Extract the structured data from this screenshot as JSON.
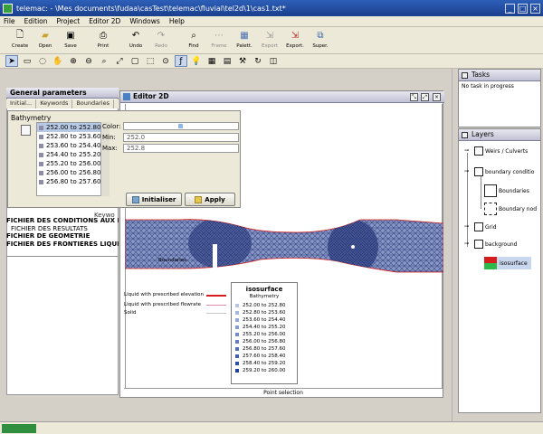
{
  "window": {
    "title": "telemac: - \\Mes documents\\fudaa\\casTest\\telemac\\fluvial\\tel2d\\1\\cas1.txt*"
  },
  "menu": [
    "File",
    "Edition",
    "Project",
    "Editor 2D",
    "Windows",
    "Help"
  ],
  "toolbar": [
    {
      "label": "Create",
      "icon": "document-icon",
      "enabled": true
    },
    {
      "label": "Open",
      "icon": "folder-icon",
      "enabled": true
    },
    {
      "label": "Save",
      "icon": "floppy-icon",
      "enabled": true
    },
    {
      "label": "Print",
      "icon": "printer-icon",
      "enabled": true
    },
    {
      "label": "Undo",
      "icon": "undo-icon",
      "enabled": true
    },
    {
      "label": "Redo",
      "icon": "redo-icon",
      "enabled": false
    },
    {
      "label": "Find",
      "icon": "find-icon",
      "enabled": true
    },
    {
      "label": "Frame",
      "icon": "frame-icon",
      "enabled": false
    },
    {
      "label": "Palett.",
      "icon": "palette-icon",
      "enabled": true
    },
    {
      "label": "Export",
      "icon": "export-icon",
      "enabled": false
    },
    {
      "label": "Export.",
      "icon": "export-icon",
      "enabled": true
    },
    {
      "label": "Super.",
      "icon": "superimpose-icon",
      "enabled": true
    }
  ],
  "general_parameters": {
    "title": "General parameters",
    "tabs": [
      "Initial...",
      "Keywords",
      "Boundaries"
    ],
    "keywords_label": "Keywo",
    "keywords": [
      {
        "text": "FICHIER DES CONDITIONS AUX LIMI",
        "bold": true
      },
      {
        "text": "FICHIER DES RESULTATS",
        "bold": false
      },
      {
        "text": "FICHIER DE GEOMETRIE",
        "bold": true
      },
      {
        "text": "FICHIER DES FRONTIERES LIQUIDES",
        "bold": true
      }
    ]
  },
  "bathymetry_panel": {
    "title": "Bathymetry",
    "ranges": [
      "252.00 to 252.80",
      "252.80 to 253.60",
      "253.60 to 254.40",
      "254.40 to 255.20",
      "255.20 to 256.00",
      "256.00 to 256.80",
      "256.80 to 257.60"
    ],
    "color_label": "Color:",
    "min_label": "Min:",
    "min_value": "252.0",
    "max_label": "Max:",
    "max_value": "252.8",
    "initialise_label": "Initialiser",
    "apply_label": "Apply"
  },
  "editor": {
    "title": "Editor 2D",
    "status": "Point selection",
    "boundaries_title": "Boundaries",
    "boundary_legend": [
      {
        "label": "Liquid with prescribed elevation",
        "color": "#d61c1c"
      },
      {
        "label": "Liquid with prescribed flowrate",
        "color": "#e08ab2"
      },
      {
        "label": "Solid",
        "color": "#c7c7c7"
      }
    ],
    "iso": {
      "title": "isosurface",
      "subtitle": "Bathymetry",
      "ranges": [
        "252.00 to 252.80",
        "252.80 to 253.60",
        "253.60 to 254.40",
        "254.40 to 255.20",
        "255.20 to 256.00",
        "256.00 to 256.80",
        "256.80 to 257.60",
        "257.60 to 258.40",
        "258.40 to 259.20",
        "259.20 to 260.00"
      ],
      "colors": [
        "#b8c6e6",
        "#a7b8de",
        "#96a9d6",
        "#859ace",
        "#748bc6",
        "#637cbe",
        "#526db6",
        "#415eae",
        "#304fa6",
        "#1f409e"
      ]
    }
  },
  "tasks": {
    "title": "Tasks",
    "status": "No task in progress"
  },
  "layers": {
    "title": "Layers",
    "items": [
      "Weirs / Culverts",
      "boundary conditio",
      "Boundaries",
      "Boundary nod",
      "Grid",
      "background",
      "isosurface"
    ]
  },
  "colors": {
    "mesh": "#4a5c9a",
    "boundary_red": "#d61c1c",
    "memory_green": "#2f8f3f"
  }
}
